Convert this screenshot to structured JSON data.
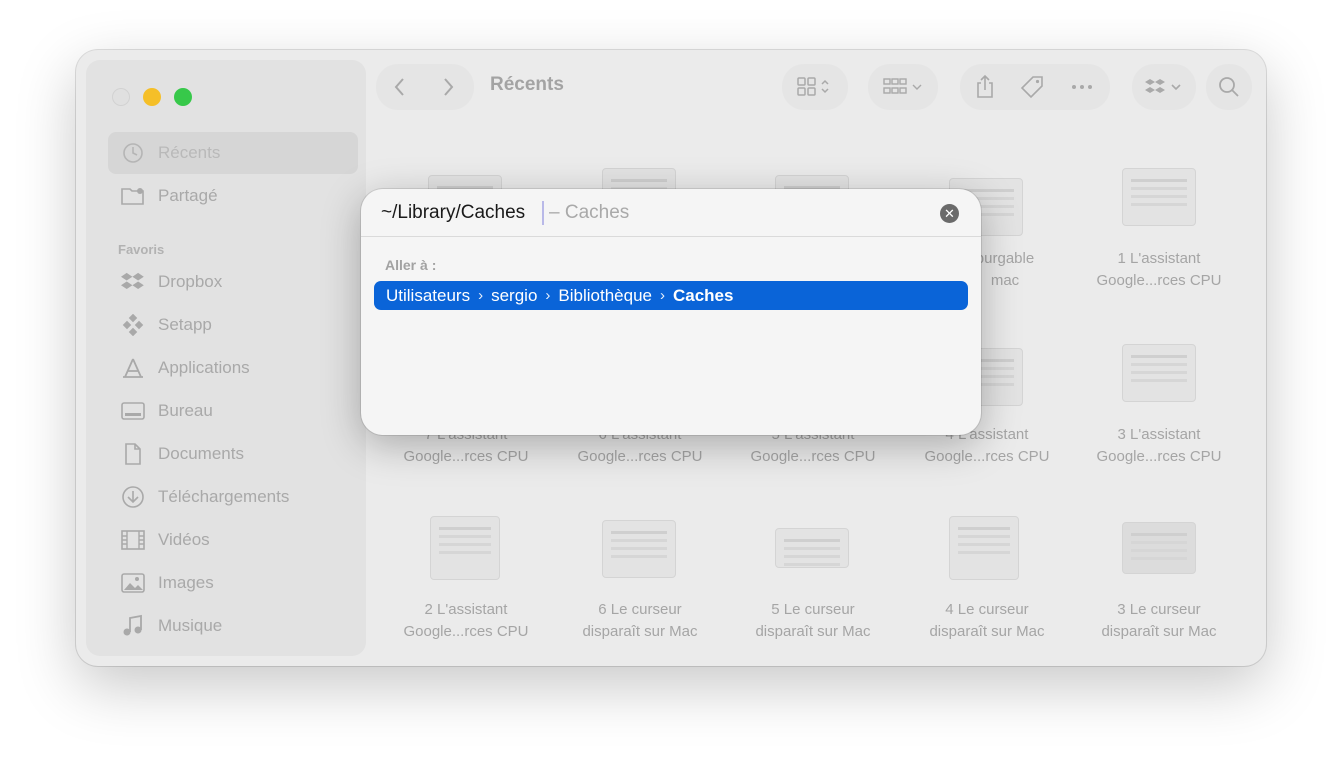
{
  "window": {
    "title": "Récents"
  },
  "sidebar": {
    "top_items": [
      {
        "label": "Récents",
        "icon": "clock-icon"
      },
      {
        "label": "Partagé",
        "icon": "shared-folder-icon"
      }
    ],
    "favorites_heading": "Favoris",
    "favorites": [
      {
        "label": "Dropbox",
        "icon": "dropbox-icon"
      },
      {
        "label": "Setapp",
        "icon": "setapp-icon"
      },
      {
        "label": "Applications",
        "icon": "applications-icon"
      },
      {
        "label": "Bureau",
        "icon": "desktop-icon"
      },
      {
        "label": "Documents",
        "icon": "document-icon"
      },
      {
        "label": "Téléchargements",
        "icon": "download-icon"
      },
      {
        "label": "Vidéos",
        "icon": "video-icon"
      },
      {
        "label": "Images",
        "icon": "image-icon"
      },
      {
        "label": "Musique",
        "icon": "music-icon"
      }
    ]
  },
  "grid": {
    "row1": [
      {
        "line1": "",
        "line2": ""
      },
      {
        "line1": "",
        "line2": ""
      },
      {
        "line1": "",
        "line2": ""
      },
      {
        "line1": "purgable",
        "line2": "mac"
      },
      {
        "line1": "1 L'assistant",
        "line2": "Google...rces CPU"
      }
    ],
    "row2": [
      {
        "line1": "7 L'assistant",
        "line2": "Google...rces CPU"
      },
      {
        "line1": "6 L'assistant",
        "line2": "Google...rces CPU"
      },
      {
        "line1": "5 L'assistant",
        "line2": "Google...rces CPU"
      },
      {
        "line1": "4 L'assistant",
        "line2": "Google...rces CPU"
      },
      {
        "line1": "3 L'assistant",
        "line2": "Google...rces CPU"
      }
    ],
    "row3": [
      {
        "line1": "2 L'assistant",
        "line2": "Google...rces CPU"
      },
      {
        "line1": "6 Le curseur",
        "line2": "disparaît sur Mac"
      },
      {
        "line1": "5 Le curseur",
        "line2": "disparaît sur Mac"
      },
      {
        "line1": "4 Le curseur",
        "line2": "disparaît sur Mac"
      },
      {
        "line1": "3 Le curseur",
        "line2": "disparaît sur Mac"
      }
    ]
  },
  "goto_dialog": {
    "input_value": "~/Library/Caches",
    "completion_hint": "– Caches",
    "label": "Aller à :",
    "suggestion": {
      "parts": [
        "Utilisateurs",
        "sergio",
        "Bibliothèque"
      ],
      "last": "Caches",
      "separator": "›"
    },
    "accent_color": "#0a64d8"
  }
}
